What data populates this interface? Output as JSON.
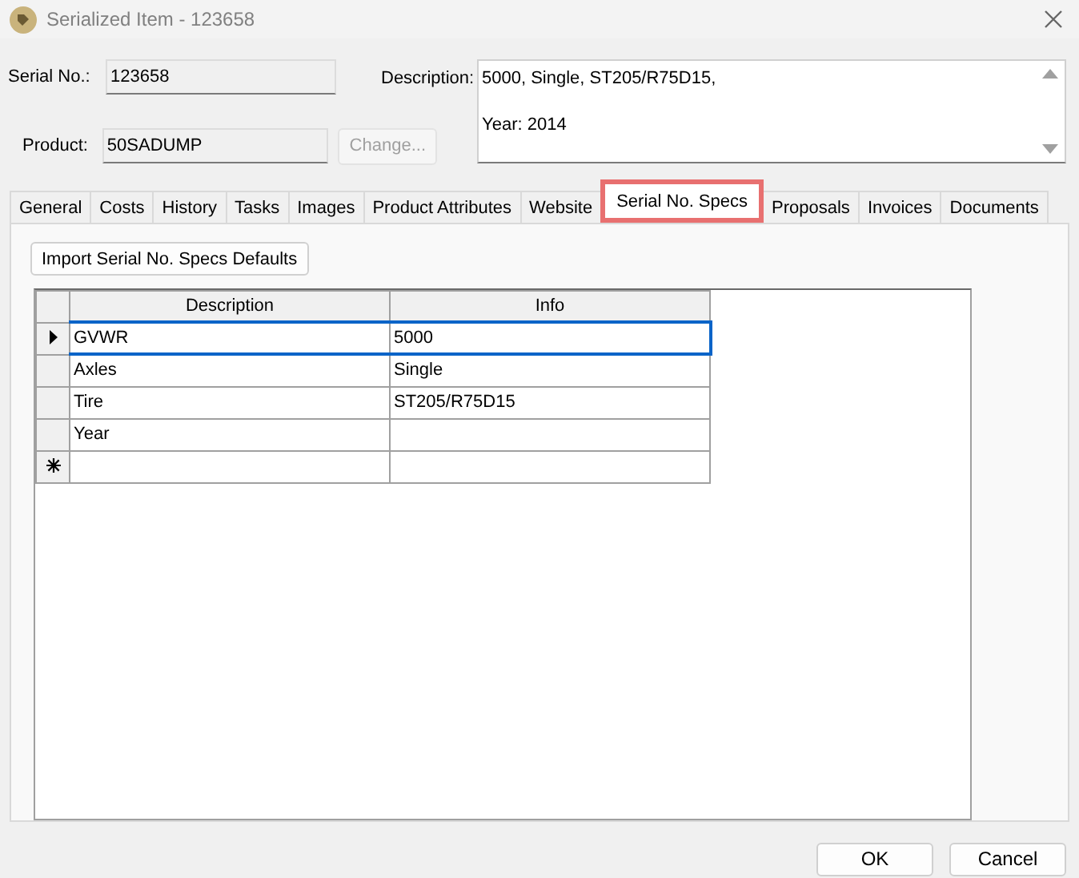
{
  "window": {
    "title": "Serialized Item - 123658"
  },
  "fields": {
    "serial_no": {
      "label": "Serial No.:",
      "value": "123658"
    },
    "product": {
      "label": "Product:",
      "value": "50SADUMP"
    },
    "change_button": {
      "label": "Change...",
      "disabled": true
    },
    "description": {
      "label": "Description:",
      "lines": [
        "5000, Single, ST205/R75D15,",
        "Year: 2014"
      ]
    }
  },
  "tabs": [
    {
      "label": "General",
      "selected": false
    },
    {
      "label": "Costs",
      "selected": false
    },
    {
      "label": "History",
      "selected": false
    },
    {
      "label": "Tasks",
      "selected": false
    },
    {
      "label": "Images",
      "selected": false
    },
    {
      "label": "Product Attributes",
      "selected": false
    },
    {
      "label": "Website",
      "selected": false
    },
    {
      "label": "Serial No. Specs",
      "selected": true
    },
    {
      "label": "Proposals",
      "selected": false
    },
    {
      "label": "Invoices",
      "selected": false
    },
    {
      "label": "Documents",
      "selected": false
    }
  ],
  "import_button": "Import Serial No. Specs Defaults",
  "table": {
    "columns": [
      "Description",
      "Info"
    ],
    "rows": [
      {
        "kind": "data",
        "selected": true,
        "cells": [
          "GVWR",
          "5000"
        ]
      },
      {
        "kind": "data",
        "selected": false,
        "cells": [
          "Axles",
          "Single"
        ]
      },
      {
        "kind": "data",
        "selected": false,
        "cells": [
          "Tire",
          "ST205/R75D15"
        ]
      },
      {
        "kind": "data",
        "selected": false,
        "cells": [
          "Year"
        ]
      },
      {
        "kind": "new",
        "selected": false,
        "cells": []
      }
    ]
  },
  "buttons": [
    "OK",
    "Cancel"
  ]
}
